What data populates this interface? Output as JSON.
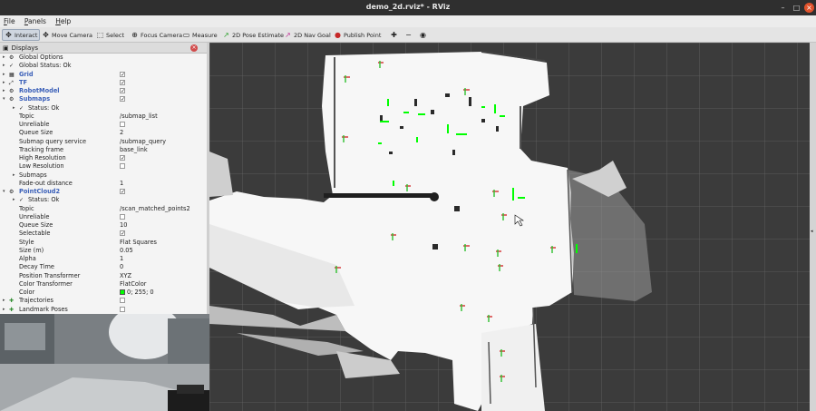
{
  "window": {
    "title": "demo_2d.rviz* - RViz",
    "minimize_icon": "minimize-icon",
    "maximize_icon": "maximize-icon",
    "close_icon": "close-icon"
  },
  "menu": {
    "items": [
      "File",
      "Panels",
      "Help"
    ]
  },
  "toolbar": {
    "tools": [
      {
        "label": "Interact",
        "icon": "interact-icon"
      },
      {
        "label": "Move Camera",
        "icon": "move-camera-icon"
      },
      {
        "label": "Select",
        "icon": "select-icon"
      },
      {
        "label": "Focus Camera",
        "icon": "focus-camera-icon"
      },
      {
        "label": "Measure",
        "icon": "measure-icon"
      },
      {
        "label": "2D Pose Estimate",
        "icon": "pose-arrow-icon"
      },
      {
        "label": "2D Nav Goal",
        "icon": "nav-goal-icon"
      },
      {
        "label": "Publish Point",
        "icon": "publish-point-icon"
      }
    ],
    "active_tool": "Interact"
  },
  "displays_panel": {
    "title": "Displays",
    "rows": [
      {
        "label": "Global Options",
        "value": ""
      },
      {
        "label": "Global Status: Ok",
        "value": ""
      },
      {
        "label": "Grid",
        "value": "✓"
      },
      {
        "label": "TF",
        "value": "✓"
      },
      {
        "label": "RobotModel",
        "value": "✓"
      },
      {
        "label": "Submaps",
        "value": "✓"
      },
      {
        "label": "Status: Ok",
        "value": ""
      },
      {
        "label": "Topic",
        "value": "/submap_list"
      },
      {
        "label": "Unreliable",
        "value": ""
      },
      {
        "label": "Queue Size",
        "value": "2"
      },
      {
        "label": "Submap query service",
        "value": "/submap_query"
      },
      {
        "label": "Tracking frame",
        "value": "base_link"
      },
      {
        "label": "High Resolution",
        "value": "✓"
      },
      {
        "label": "Low Resolution",
        "value": ""
      },
      {
        "label": "Submaps",
        "value": ""
      },
      {
        "label": "Fade-out distance",
        "value": "1"
      },
      {
        "label": "PointCloud2",
        "value": "✓"
      },
      {
        "label": "Status: Ok",
        "value": ""
      },
      {
        "label": "Topic",
        "value": "/scan_matched_points2"
      },
      {
        "label": "Unreliable",
        "value": ""
      },
      {
        "label": "Queue Size",
        "value": "10"
      },
      {
        "label": "Selectable",
        "value": "✓"
      },
      {
        "label": "Style",
        "value": "Flat Squares"
      },
      {
        "label": "Size (m)",
        "value": "0.05"
      },
      {
        "label": "Alpha",
        "value": "1"
      },
      {
        "label": "Decay Time",
        "value": "0"
      },
      {
        "label": "Position Transformer",
        "value": "XYZ"
      },
      {
        "label": "Color Transformer",
        "value": "FlatColor"
      },
      {
        "label": "Color",
        "value": "0; 255; 0"
      },
      {
        "label": "Trajectories",
        "value": ""
      },
      {
        "label": "Landmark Poses",
        "value": ""
      }
    ]
  },
  "colors": {
    "pointcloud": "#00ff00",
    "grid": "#6a6a6a",
    "background": "#3b3b3b",
    "close_button": "#e0522b"
  }
}
